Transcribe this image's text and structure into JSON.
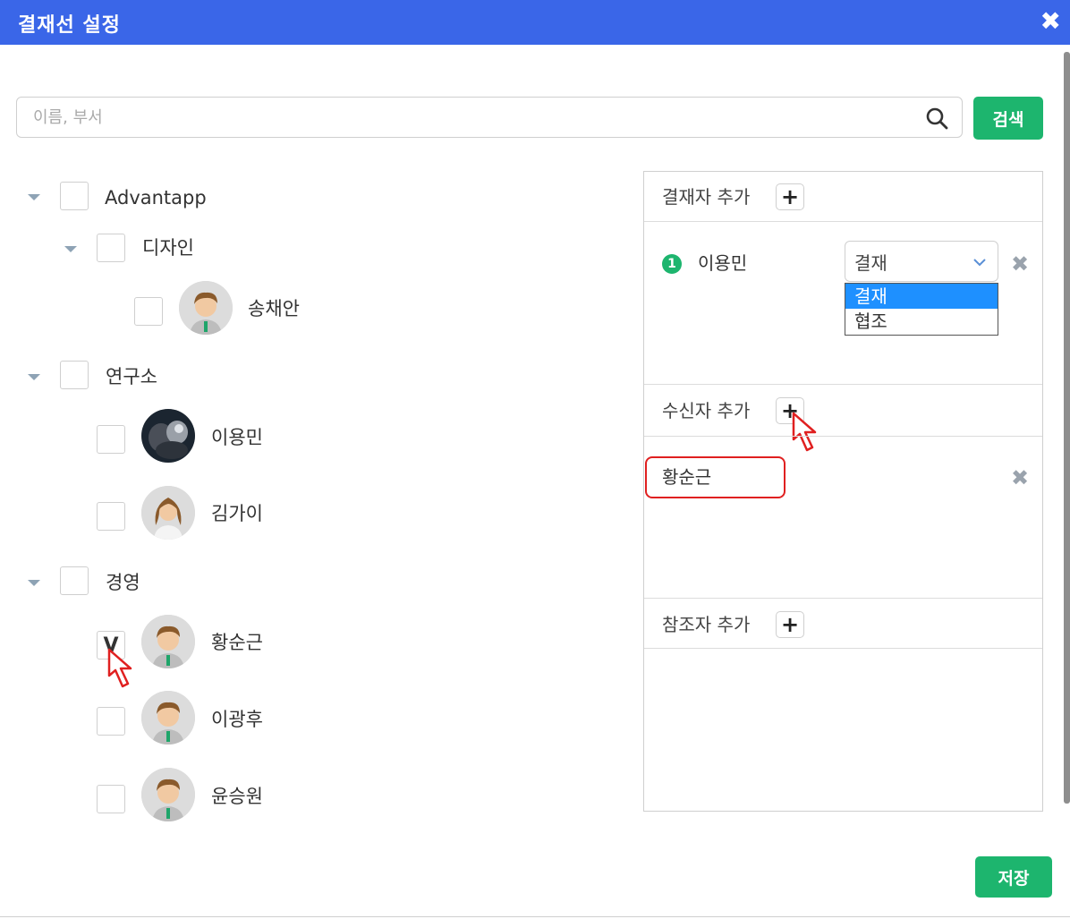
{
  "dialog": {
    "title": "결재선 설정",
    "close_icon": "✖"
  },
  "search": {
    "placeholder": "이름, 부서",
    "value": "",
    "button_label": "검색"
  },
  "tree": {
    "org": "Advantapp",
    "dept_design": "디자인",
    "user_songchaean": "송채안",
    "dept_research": "연구소",
    "user_leeyongmin": "이용민",
    "user_kimgai": "김가이",
    "dept_management": "경영",
    "user_hwangsoongeun": "황순근",
    "user_hwangsoongeun_check": "V",
    "user_leegwanghu": "이광후",
    "user_yunseungwon": "윤승원"
  },
  "approvers": {
    "header": "결재자 추가",
    "add_symbol": "+",
    "item": {
      "order": "1",
      "name": "이용민",
      "role_selected": "결재"
    },
    "role_options": [
      "결재",
      "협조"
    ],
    "remove_symbol": "✖"
  },
  "receivers": {
    "header": "수신자 추가",
    "add_symbol": "+",
    "item_name": "황순근",
    "remove_symbol": "✖"
  },
  "references": {
    "header": "참조자 추가",
    "add_symbol": "+"
  },
  "footer": {
    "save_label": "저장"
  },
  "colors": {
    "title_bar": "#3a66e8",
    "primary_button": "#1db56e",
    "highlight": "#e02020",
    "selected_option": "#1e90ff"
  }
}
